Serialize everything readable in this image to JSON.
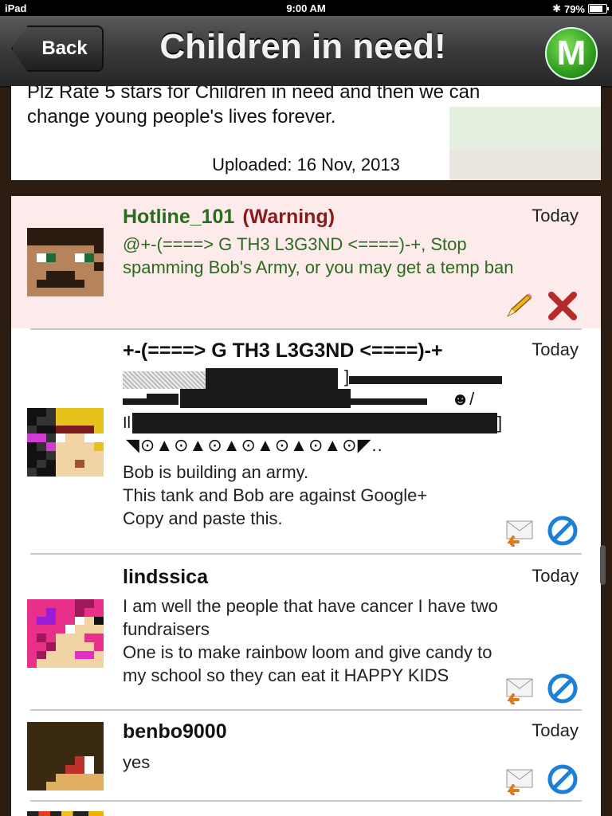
{
  "status": {
    "device": "iPad",
    "time": "9:00 AM",
    "battery": "79%",
    "battery_level": 0.79
  },
  "nav": {
    "back_label": "Back",
    "title": "Children in need!",
    "logo_letter": "M"
  },
  "description": {
    "text_line1": "Plz Rate 5 stars for Children in need and then we can",
    "text_line2": "change young people's lives forever.",
    "uploaded": "Uploaded: 16 Nov, 2013"
  },
  "comments": [
    {
      "user": "Hotline_101",
      "warning": "(Warning)",
      "time": "Today",
      "text": "@+-(====> G TH3 L3G3ND <====)-+,  Stop spamming Bob's Army, or you may get a temp ban",
      "actions": [
        "pencil-icon",
        "delete-x-icon"
      ]
    },
    {
      "user": "+-(====> G TH3 L3G3ND <====)-+",
      "time": "Today",
      "art_face": "☻/",
      "art_wheels": "◥⊙▲⊙▲⊙▲⊙▲⊙▲⊙▲⊙◤..",
      "art_bracket": "]",
      "art_left": "Il",
      "text": "Bob is building an army.\nThis tank and Bob are against Google+\nCopy and paste this.",
      "actions": [
        "reply-mail-icon",
        "block-icon"
      ]
    },
    {
      "user": "lindssica",
      "time": "Today",
      "text": "I am well the people that have cancer I have two fundraisers\nOne is to make rainbow loom and give candy to my school so they can eat it HAPPY KIDS",
      "actions": [
        "reply-mail-icon",
        "block-icon"
      ]
    },
    {
      "user": "benbo9000",
      "time": "Today",
      "text": "yes",
      "actions": [
        "reply-mail-icon",
        "block-icon"
      ]
    }
  ],
  "colors": {
    "warning_bg": "#fdeaea",
    "warning_text": "#8a1b1b",
    "green_text": "#2b6b1f"
  }
}
